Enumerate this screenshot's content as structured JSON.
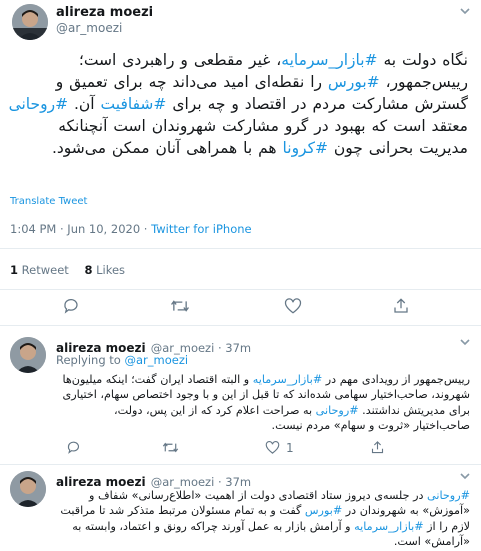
{
  "main_tweet": {
    "author_name": "alireza moezi",
    "author_handle": "@ar_moezi",
    "text_segments": [
      {
        "t": "نگاه دولت به ",
        "tag": false
      },
      {
        "t": "#بازار_سرمایه",
        "tag": true
      },
      {
        "t": "، غیر مقطعی و راهبردی است؛ رییس‌جمهور، ",
        "tag": false
      },
      {
        "t": "#بورس",
        "tag": true
      },
      {
        "t": " را نقطه‌ای امید می‌داند چه برای تعمیق و گسترش مشارکت مردم در اقتصاد و چه برای ",
        "tag": false
      },
      {
        "t": "#شفافیت",
        "tag": true
      },
      {
        "t": " آن. ",
        "tag": false
      },
      {
        "t": "#روحانی",
        "tag": true
      },
      {
        "t": " معتقد است که بهبود در گرو مشارکت شهروندان است آنچنانکه مدیریت بحرانی چون ",
        "tag": false
      },
      {
        "t": "#کرونا",
        "tag": true
      },
      {
        "t": " هم با همراهی آنان ممکن می‌شود.",
        "tag": false
      }
    ],
    "translate_label": "Translate Tweet",
    "timestamp": "1:04 PM · Jun 10, 2020 · ",
    "source": "Twitter for iPhone",
    "retweet_count": "1",
    "retweet_label": "Retweet",
    "like_count": "8",
    "like_label": "Likes"
  },
  "replies": [
    {
      "author_name": "alireza moezi",
      "author_handle": "@ar_moezi · 37m",
      "replying_label": "Replying to ",
      "replying_handle": "@ar_moezi",
      "text_segments": [
        {
          "t": "رییس‌جمهور از رویدادی مهم در ",
          "tag": false
        },
        {
          "t": "#بازار_سرمایه",
          "tag": true
        },
        {
          "t": " و البته اقتصاد ایران گفت؛ اینکه میلیون‌ها شهروند، صاحب‌اختیار سهامی شده‌اند که تا قبل از این و با وجود اختصاص سهام، اختیاری برای مدیریتش نداشتند. ",
          "tag": false
        },
        {
          "t": "#روحانی",
          "tag": true
        },
        {
          "t": " به صراحت اعلام کرد که از این پس، دولت، صاحب‌اختیار «ثروت و سهام» مردم نیست.",
          "tag": false
        }
      ],
      "like_count": "1"
    },
    {
      "author_name": "alireza moezi",
      "author_handle": "@ar_moezi · 37m",
      "text_segments": [
        {
          "t": "#روحانی",
          "tag": true
        },
        {
          "t": " در جلسه‌ی دیروز ستاد اقتصادی دولت از اهمیت «اطلاع‌رسانی» شفاف و «آموزش» به شهروندان در ",
          "tag": false
        },
        {
          "t": "#بورس",
          "tag": true
        },
        {
          "t": " گفت و به تمام مسئولان مرتبط متذکر شد تا مراقبت لازم را از ",
          "tag": false
        },
        {
          "t": "#بازار_سرمایه",
          "tag": true
        },
        {
          "t": " و آرامش بازار به عمل آورند چراکه رونق و اعتماد، وابسته به «آرامش» است.",
          "tag": false
        }
      ]
    }
  ]
}
